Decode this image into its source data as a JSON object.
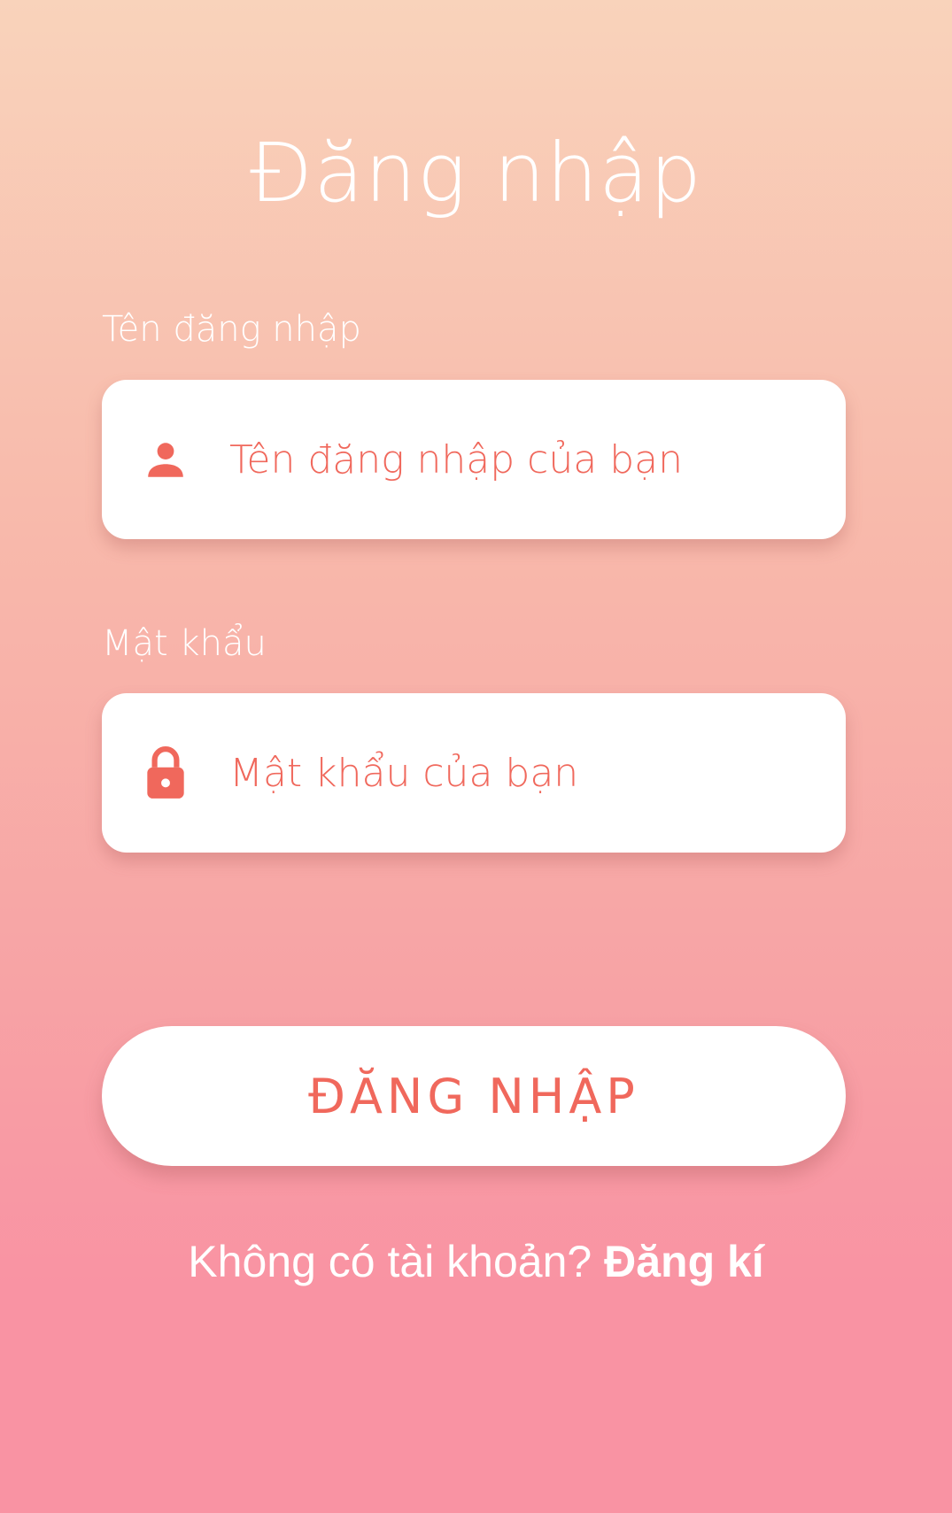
{
  "page": {
    "title": "Đăng nhập"
  },
  "username": {
    "label": "Tên đăng nhập",
    "placeholder": "Tên đăng nhập của bạn",
    "value": "",
    "icon": "person-icon"
  },
  "password": {
    "label": "Mật khẩu",
    "placeholder": "Mật khẩu của bạn",
    "value": "",
    "icon": "lock-icon"
  },
  "login_button": {
    "label": "ĐĂNG NHẬP"
  },
  "signup": {
    "prompt": "Không có tài khoản? ",
    "link_label": "Đăng kí"
  },
  "colors": {
    "accent": "#f0685c",
    "gradient_top": "#f9d3bb",
    "gradient_bottom": "#f993a3",
    "card": "#ffffff"
  }
}
